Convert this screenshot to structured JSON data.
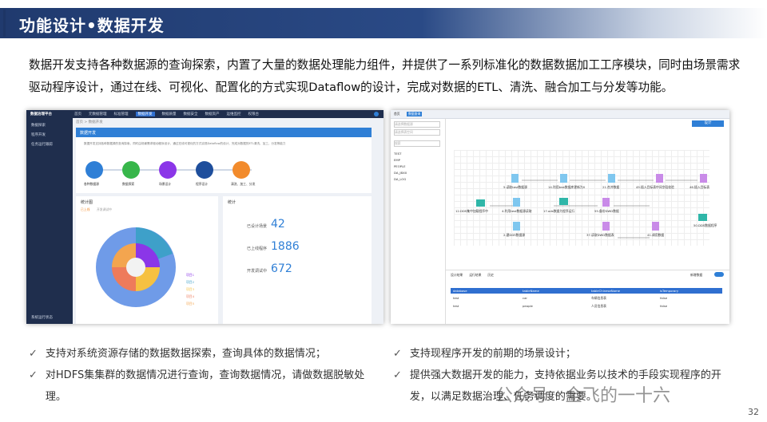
{
  "title": "功能设计•数据开发",
  "intro": "数据开发支持各种数据源的查询探索，内置了大量的数据处理能力组件，并提供了一系列标准化的数据数据加工工序模块，同时由场景需求驱动程序设计，通过在线、可视化、配置化的方式实现Dataflow的设计，完成对数据的ETL、清洗、融合加工与分发等功能。",
  "left_shot": {
    "app_name": "数据治理平台",
    "nav": [
      "首页",
      "元数据管理",
      "标准管理",
      "数据开发",
      "数据质量",
      "数据安全",
      "数据资产",
      "运维监控",
      "权限台"
    ],
    "side": [
      "数据探索",
      "程序开发",
      "任务运行跟踪"
    ],
    "breadcrumb": "首页 > 数据开发",
    "banner_title": "数据开发",
    "banner_desc": "数据开发支持各种数据源的查询探索，同时由场景需求驱动程序设计，通过在线可视化的方式实现Dataflow的设计，完成对数据的ETL清洗、加工、分发等能力",
    "flow": [
      "各种数据源",
      "数据探索",
      "场景设计",
      "程序设计",
      "清洗、加工、分发"
    ],
    "stats_chart_title": "统计图",
    "legend_top": [
      "已上线",
      "开发调试中"
    ],
    "stats_title": "统计",
    "stats": [
      {
        "label": "已设计场景",
        "value": "42"
      },
      {
        "label": "已上线程序",
        "value": "1886"
      },
      {
        "label": "开发调试中",
        "value": "672"
      }
    ],
    "pie_legend": [
      "项目1",
      "项目2",
      "项目3",
      "项目4",
      "项目5"
    ],
    "bottom_status": "系统运行状态"
  },
  "right_shot": {
    "tabs": [
      "首页",
      "数据查询"
    ],
    "selects": [
      "请选择数据源",
      "请选择表空间",
      "搜索"
    ],
    "tables": [
      "TEST",
      "EMP",
      "PEOPLE",
      "DA_JBXX",
      "DA_LOG"
    ],
    "design_button": "设计",
    "nodes": [
      "5.读取test数据源",
      "14.利用test数据库更新为0",
      "21.合并数据",
      "45.插入目标表中间字段校验",
      "46.插入目标表",
      "12.DDS集中加载程序中",
      "4.利用test数据源读取",
      "17.ods数据为程序运行",
      "55.备份DWD数据",
      "50.DDS数据程序",
      "2.建DDS数据源",
      "37.读取DWD数据表",
      "41.调用数据"
    ],
    "bottom_tabs": [
      "设计结果",
      "运行结果",
      "历史"
    ],
    "toggle_label": "新增数据",
    "columns": [
      "database",
      "tableName",
      "tableChineseName",
      "isTemporary"
    ],
    "rows": [
      [
        "test",
        "car",
        "车辆信息表",
        "false"
      ],
      [
        "test",
        "people",
        "人员信息表",
        "false"
      ]
    ]
  },
  "bullets_left": [
    "支持对系统资源存储的数据数据探索，查询具体的数据情况；",
    "对HDFS集集群的数据情况进行查询，查询数据情况，请做数据脱敏处理。"
  ],
  "bullets_right": [
    "支持现程序开发的前期的场景设计；",
    "提供强大数据开发的能力，支持依据业务以技术的手段实现程序的开发，以满足数据治理、任务调度的需要。"
  ],
  "watermark": "公众号 · 全飞的一十六",
  "page_number": "32",
  "colors": {
    "accent": "#203a6e",
    "value_blue": "#2f7fd6"
  }
}
